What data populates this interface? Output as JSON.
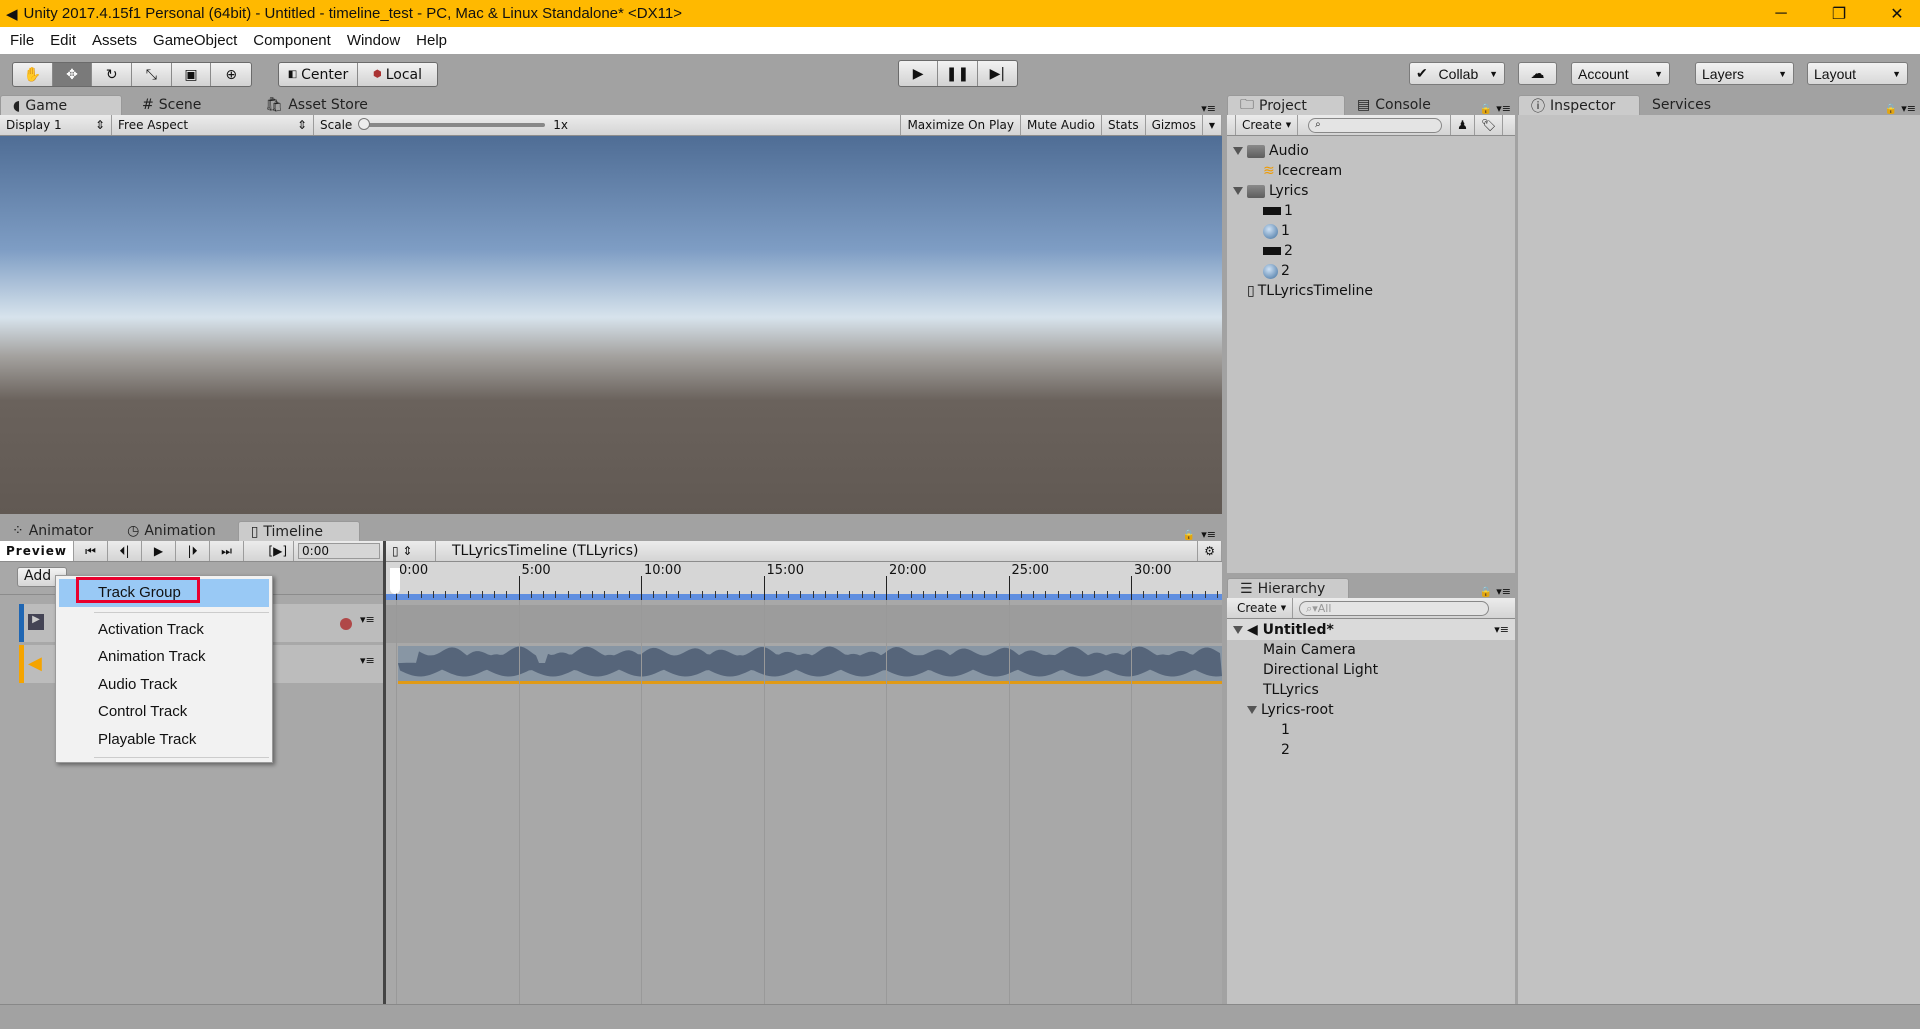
{
  "window": {
    "title": "Unity 2017.4.15f1 Personal (64bit) - Untitled - timeline_test - PC, Mac & Linux Standalone* <DX11>",
    "minimize": "─",
    "restore": "❐",
    "close": "✕"
  },
  "menubar": [
    "File",
    "Edit",
    "Assets",
    "GameObject",
    "Component",
    "Window",
    "Help"
  ],
  "toolbar": {
    "tools": [
      "hand-icon",
      "move-icon",
      "rotate-icon",
      "scale-icon",
      "rect-icon",
      "transform-icon"
    ],
    "active_tool": "move-icon",
    "pivot": "Center",
    "space": "Local",
    "collab": "Collab",
    "account": "Account",
    "layers": "Layers",
    "layout": "Layout"
  },
  "game_panel": {
    "tabs": [
      "Game",
      "Scene",
      "Asset Store"
    ],
    "active_tab": "Game",
    "display": "Display 1",
    "aspect": "Free Aspect",
    "scale_label": "Scale",
    "scale_value": "1x",
    "buttons": [
      "Maximize On Play",
      "Mute Audio",
      "Stats",
      "Gizmos"
    ]
  },
  "project_panel": {
    "tabs": [
      "Project",
      "Console"
    ],
    "create": "Create",
    "items": [
      {
        "label": "Audio",
        "type": "folder",
        "depth": 0
      },
      {
        "label": "Icecream",
        "type": "audio",
        "depth": 1
      },
      {
        "label": "Lyrics",
        "type": "folder",
        "depth": 0
      },
      {
        "label": "1",
        "type": "texture",
        "depth": 1
      },
      {
        "label": "1",
        "type": "material",
        "depth": 1
      },
      {
        "label": "2",
        "type": "texture",
        "depth": 1
      },
      {
        "label": "2",
        "type": "material",
        "depth": 1
      },
      {
        "label": "TLLyricsTimeline",
        "type": "timeline",
        "depth": 0
      }
    ]
  },
  "inspector_panel": {
    "tabs": [
      "Inspector",
      "Services"
    ]
  },
  "hierarchy_panel": {
    "tab": "Hierarchy",
    "create": "Create",
    "search_placeholder": "All",
    "scene": "Untitled*",
    "items": [
      {
        "label": "Main Camera",
        "depth": 1
      },
      {
        "label": "Directional Light",
        "depth": 1
      },
      {
        "label": "TLLyrics",
        "depth": 1
      },
      {
        "label": "Lyrics-root",
        "depth": 1,
        "expanded": true
      },
      {
        "label": "1",
        "depth": 2
      },
      {
        "label": "2",
        "depth": 2
      }
    ]
  },
  "bottom_panel": {
    "tabs": [
      "Animator",
      "Animation",
      "Timeline"
    ],
    "active_tab": "Timeline",
    "preview": "Preview",
    "time": "0:00",
    "add": "Add",
    "timeline_name": "TLLyricsTimeline (TLLyrics)",
    "ruler": [
      "0:00",
      "5:00",
      "10:00",
      "15:00",
      "20:00",
      "25:00",
      "30:00"
    ]
  },
  "add_menu": {
    "items": [
      "Track Group",
      "Activation Track",
      "Animation Track",
      "Audio Track",
      "Control Track",
      "Playable Track"
    ],
    "highlighted": "Track Group"
  },
  "colors": {
    "titlebar": "#ffb900",
    "highlight": "#99c9f5",
    "annotation": "#e8002d",
    "activation_track": "#1f66b3",
    "audio_track": "#f5a400"
  }
}
